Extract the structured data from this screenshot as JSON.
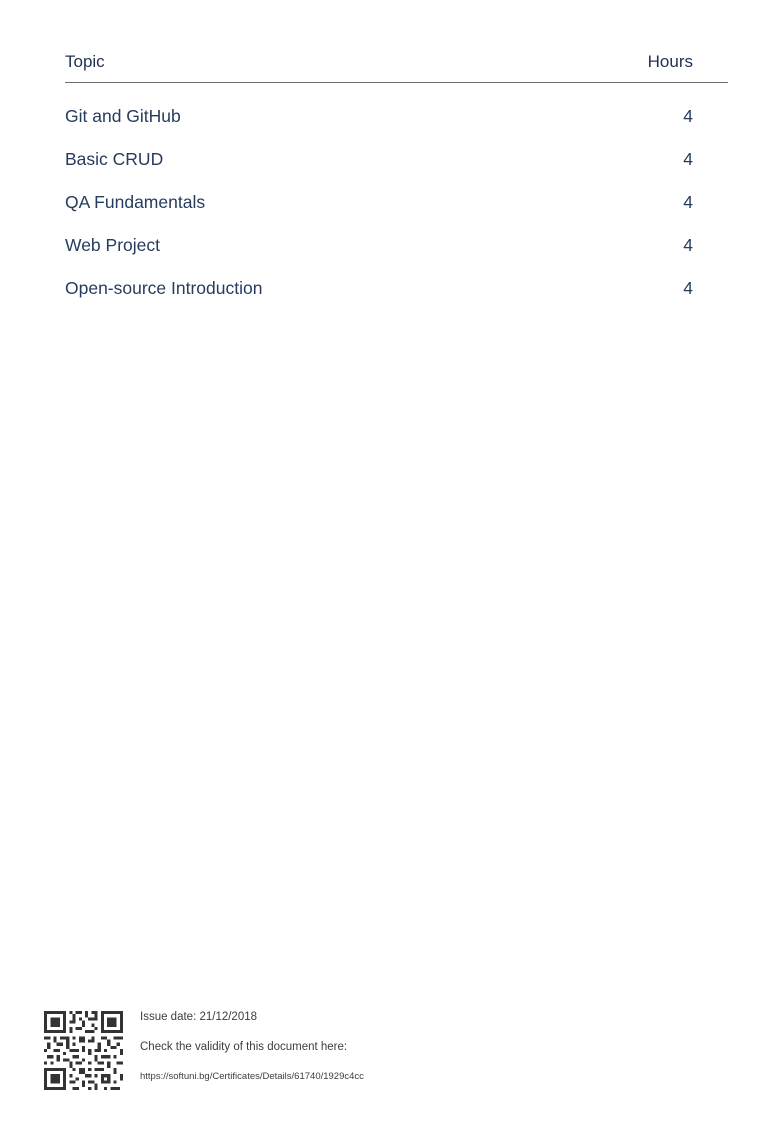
{
  "table": {
    "header": {
      "topic": "Topic",
      "hours": "Hours"
    },
    "rows": [
      {
        "topic": "Git and GitHub",
        "hours": "4"
      },
      {
        "topic": "Basic CRUD",
        "hours": "4"
      },
      {
        "topic": "QA Fundamentals",
        "hours": "4"
      },
      {
        "topic": "Web Project",
        "hours": "4"
      },
      {
        "topic": "Open-source Introduction",
        "hours": "4"
      }
    ]
  },
  "footer": {
    "qr_icon": "qr-code-icon",
    "issue_date": "Issue date: 21/12/2018",
    "check_text": "Check the validity of this document here:",
    "url": "https://softuni.bg/Certificates/Details/61740/1929c4cc"
  },
  "colors": {
    "text": "#263c5e",
    "rule": "#6b6b6b",
    "footer_text": "#3d3d3d"
  }
}
